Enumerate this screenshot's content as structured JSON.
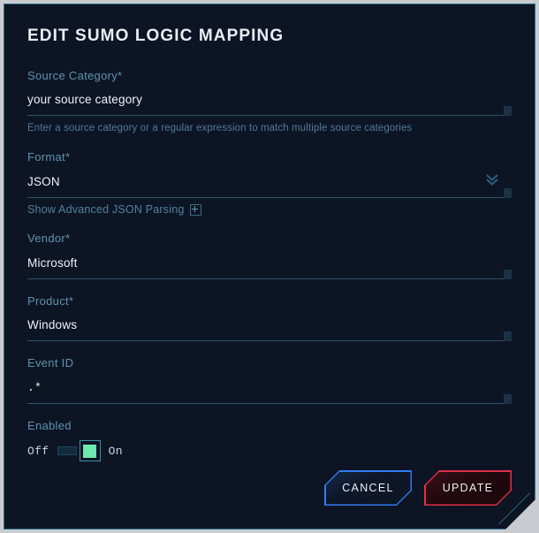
{
  "dialog": {
    "title": "EDIT SUMO LOGIC MAPPING"
  },
  "fields": {
    "source_category": {
      "label": "Source Category*",
      "value": "your source category",
      "helper": "Enter a source category or a regular expression to match multiple source categories"
    },
    "format": {
      "label": "Format*",
      "value": "JSON",
      "icon": "chevron-double-down-icon"
    },
    "advanced": {
      "label": "Show Advanced JSON Parsing",
      "icon": "plus-box-icon"
    },
    "vendor": {
      "label": "Vendor*",
      "value": "Microsoft"
    },
    "product": {
      "label": "Product*",
      "value": "Windows"
    },
    "event_id": {
      "label": "Event ID",
      "value": ".*"
    },
    "enabled": {
      "label": "Enabled",
      "off_label": "Off",
      "on_label": "On",
      "state": "On"
    }
  },
  "footer": {
    "cancel_label": "CANCEL",
    "update_label": "UPDATE"
  },
  "colors": {
    "page_background": "#c8ccd0",
    "dialog_background": "#0d1524",
    "dialog_border": "#2d6a83",
    "label_text": "#5e93b0",
    "value_text": "#edf2f7",
    "helper_text": "#4c7b98",
    "toggle_on": "#6ee7b0",
    "cancel_accent": "#2f7bf0",
    "update_accent": "#e0304a"
  }
}
